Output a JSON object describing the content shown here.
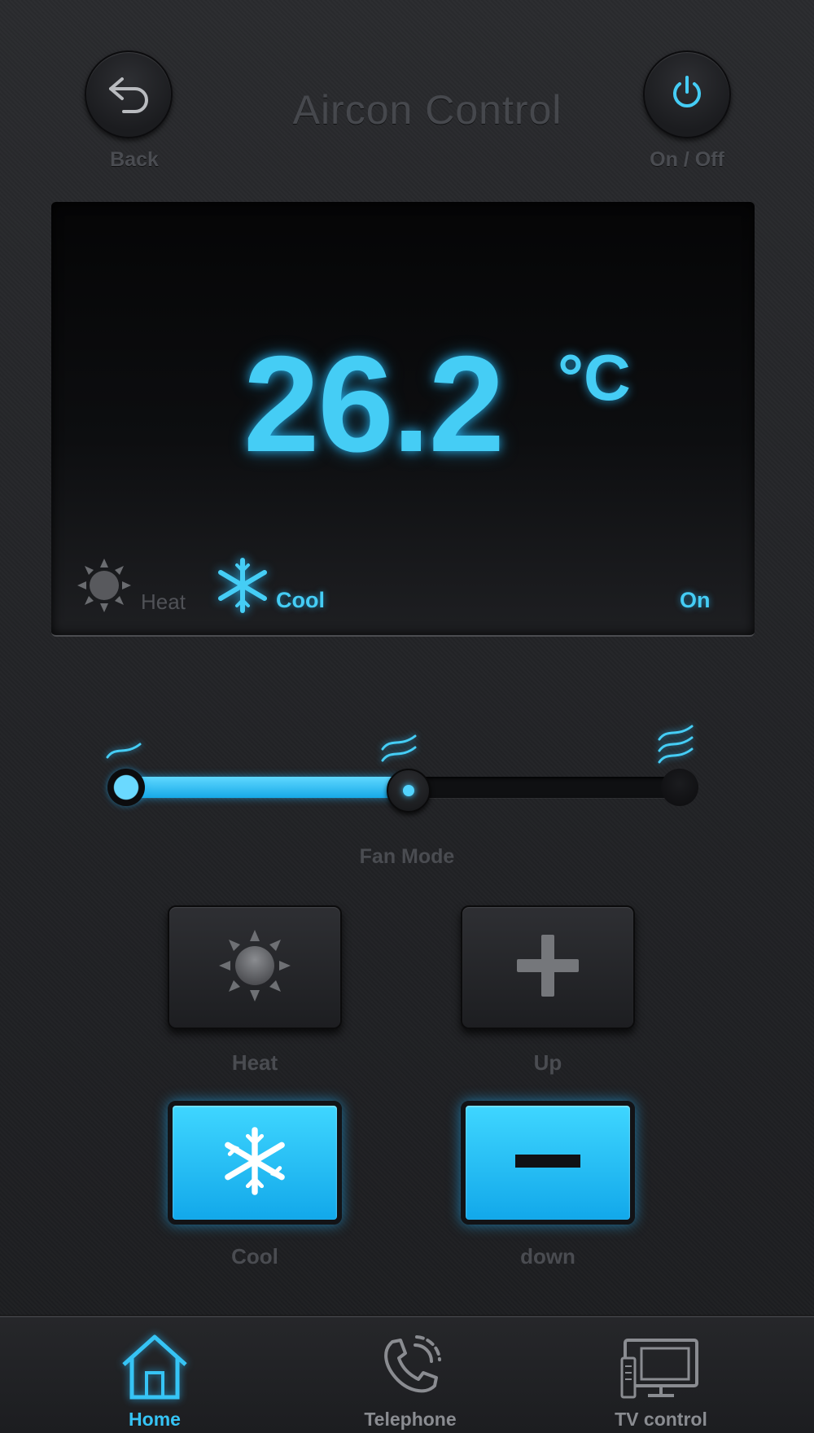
{
  "header": {
    "title": "Aircon Control",
    "back_label": "Back",
    "power_label": "On / Off"
  },
  "display": {
    "temperature": "26.2",
    "unit": "°C",
    "heat_label": "Heat",
    "cool_label": "Cool",
    "active_mode": "Cool",
    "power_state": "On"
  },
  "fan": {
    "label": "Fan Mode",
    "levels": [
      "low",
      "medium",
      "high"
    ],
    "selected_level": "medium",
    "position_fraction": 0.5
  },
  "controls": {
    "heat_label": "Heat",
    "up_label": "Up",
    "cool_label": "Cool",
    "down_label": "down"
  },
  "nav": {
    "items": [
      {
        "label": "Home",
        "icon": "home-icon",
        "active": true
      },
      {
        "label": "Telephone",
        "icon": "telephone-icon",
        "active": false
      },
      {
        "label": "TV control",
        "icon": "tv-icon",
        "active": false
      }
    ]
  },
  "colors": {
    "accent": "#45cdf5",
    "background": "#232427",
    "muted_text": "#4a4c51"
  }
}
